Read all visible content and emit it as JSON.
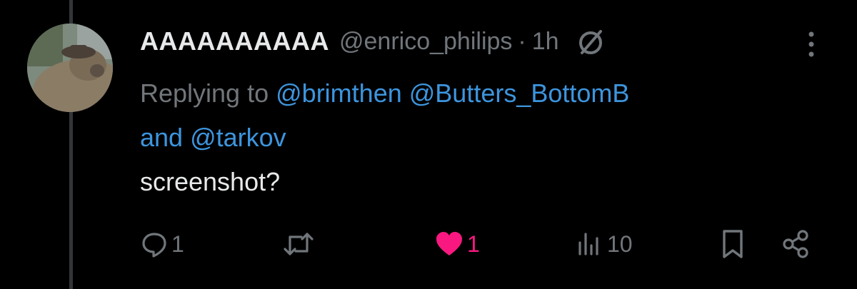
{
  "tweet": {
    "display_name": "AAAAAAAAAA",
    "handle": "@enrico_philips",
    "separator": "·",
    "time": "1h",
    "replying_prefix": "Replying to",
    "mentions": [
      "@brimthen",
      "@Butters_BottomB",
      "@tarkov"
    ],
    "mention_joiner": "and",
    "text": "screenshot?"
  },
  "actions": {
    "reply_count": "1",
    "retweet_count": "",
    "like_count": "1",
    "view_count": "10"
  },
  "icons": {
    "reply": "reply-icon",
    "retweet": "retweet-icon",
    "like": "heart-icon",
    "views": "views-icon",
    "bookmark": "bookmark-icon",
    "share": "share-icon",
    "more": "more-vertical-icon",
    "grok": "slash-circle-icon"
  },
  "colors": {
    "background": "#000000",
    "text": "#e7e9ea",
    "muted": "#71767b",
    "link": "#3d95de",
    "like": "#f91880"
  }
}
